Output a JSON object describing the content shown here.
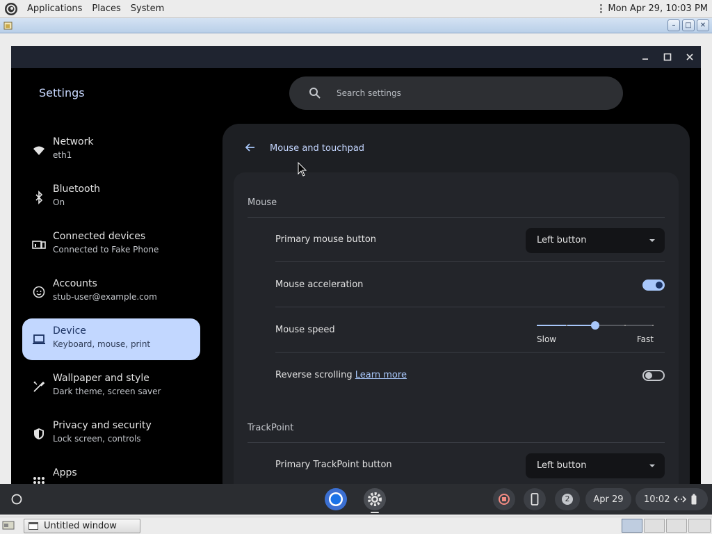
{
  "top_panel": {
    "menus": [
      "Applications",
      "Places",
      "System"
    ],
    "clock": "Mon Apr 29, 10:03 PM"
  },
  "outer_window": {
    "buttons": [
      "minimize",
      "maximize",
      "close"
    ]
  },
  "settings": {
    "title": "Settings",
    "search_placeholder": "Search settings",
    "sidebar": [
      {
        "label": "Network",
        "sub": "eth1",
        "icon": "wifi-icon"
      },
      {
        "label": "Bluetooth",
        "sub": "On",
        "icon": "bluetooth-icon"
      },
      {
        "label": "Connected devices",
        "sub": "Connected to Fake Phone",
        "icon": "phone-hub-icon"
      },
      {
        "label": "Accounts",
        "sub": "stub-user@example.com",
        "icon": "account-icon"
      },
      {
        "label": "Device",
        "sub": "Keyboard, mouse, print",
        "icon": "laptop-icon",
        "active": true
      },
      {
        "label": "Wallpaper and style",
        "sub": "Dark theme, screen saver",
        "icon": "paintbrush-icon"
      },
      {
        "label": "Privacy and security",
        "sub": "Lock screen, controls",
        "icon": "shield-icon"
      },
      {
        "label": "Apps",
        "sub": "",
        "icon": "apps-grid-icon"
      }
    ],
    "page": {
      "title": "Mouse and touchpad",
      "mouse_section": "Mouse",
      "primary_button_label": "Primary mouse button",
      "primary_button_value": "Left button",
      "acceleration_label": "Mouse acceleration",
      "acceleration_on": true,
      "speed_label": "Mouse speed",
      "speed_value": 0.5,
      "speed_min": "Slow",
      "speed_max": "Fast",
      "reverse_label": "Reverse scrolling",
      "reverse_link": "Learn more",
      "reverse_on": false,
      "trackpoint_section": "TrackPoint",
      "trackpoint_button_label": "Primary TrackPoint button",
      "trackpoint_button_value": "Left button"
    }
  },
  "shelf": {
    "notification_count": "2",
    "date": "Apr 29",
    "time": "10:02"
  },
  "taskbar": {
    "window_title": "Untitled window"
  },
  "colors": {
    "accent": "#a8c7fa",
    "active_nav": "#c2d7ff",
    "background": "#000000",
    "card": "#23252a"
  }
}
